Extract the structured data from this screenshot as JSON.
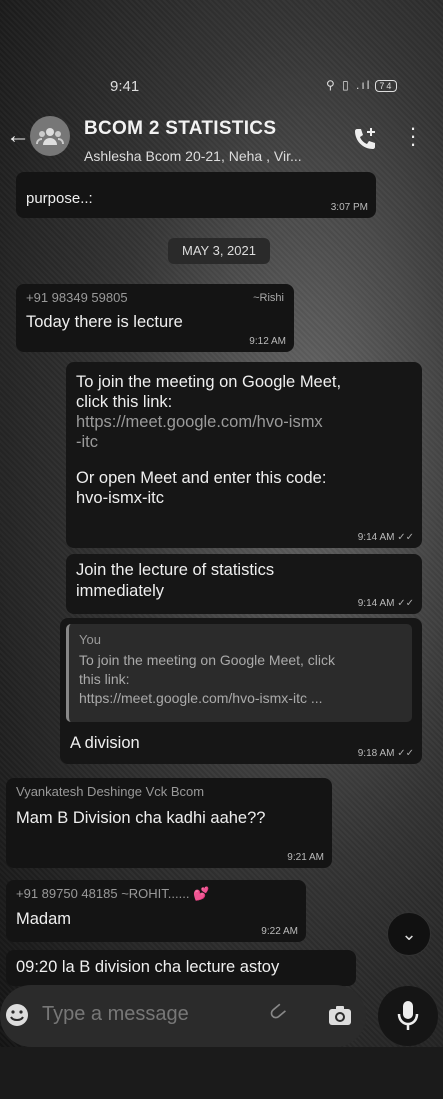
{
  "status": {
    "time": "9:41",
    "battery": "74"
  },
  "header": {
    "title": "BCOM 2 STATISTICS",
    "subtitle": "Ashlesha Bcom 20-21, Neha , Vir..."
  },
  "messages": [
    {
      "partial_text": "purpose..:",
      "time": "3:07 PM"
    },
    {
      "date": "MAY 3, 2021"
    },
    {
      "sender": "+91 98349 59805",
      "pushname": "~Rishi",
      "text": "Today there is lecture",
      "time": "9:12 AM"
    },
    {
      "text_lines": [
        "To join the meeting on Google Meet,",
        "click this link:",
        "https://meet.google.com/hvo-ismx",
        "-itc",
        "",
        "Or open Meet and enter this code:",
        "hvo-ismx-itc"
      ],
      "time": "9:14 AM"
    },
    {
      "text_lines": [
        "Join the lecture of statistics",
        "immediately"
      ],
      "time": "9:14 AM"
    },
    {
      "quote_name": "You",
      "quote_lines": [
        "To join the meeting on Google Meet, click",
        "this link:",
        "https://meet.google.com/hvo-ismx-itc ..."
      ],
      "text": "A division",
      "time": "9:18 AM"
    },
    {
      "sender": "Vyankatesh Deshinge Vck Bcom",
      "text": "Mam B Division cha kadhi aahe??",
      "time": "9:21 AM"
    },
    {
      "sender": "+91 89750 48185",
      "pushname": "~ROHIT......",
      "text": "Madam",
      "time": "9:22 AM"
    },
    {
      "text": "09:20 la B division cha lecture astoy"
    }
  ],
  "input": {
    "placeholder": "Type a message"
  },
  "colors": {
    "bubble": "#141414",
    "background": "#3a3a3a"
  }
}
